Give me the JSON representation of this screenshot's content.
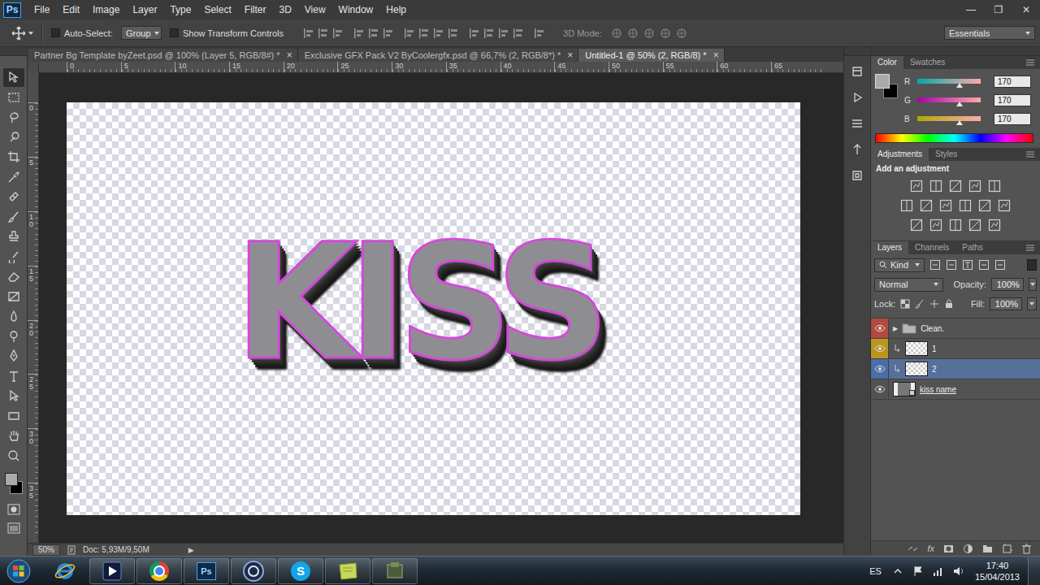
{
  "app": {
    "logo": "Ps",
    "menu": [
      "File",
      "Edit",
      "Image",
      "Layer",
      "Type",
      "Select",
      "Filter",
      "3D",
      "View",
      "Window",
      "Help"
    ],
    "window_controls": [
      "—",
      "❐",
      "✕"
    ]
  },
  "options_bar": {
    "auto_select": {
      "label": "Auto-Select:",
      "checked": false
    },
    "auto_select_target": "Group",
    "show_transform": {
      "label": "Show Transform Controls",
      "checked": false
    },
    "mode_3d": "3D Mode:",
    "workspace": "Essentials"
  },
  "document_tabs": [
    {
      "label": "Partner Bg Template byZeet.psd @ 100% (Layer 5, RGB/8#) *",
      "close": "×",
      "selected": false
    },
    {
      "label": "Exclusive GFX Pack V2 ByCoolergfx.psd @ 66,7% (2, RGB/8*) *",
      "close": "×",
      "selected": false
    },
    {
      "label": "Untitled-1 @ 50% (2, RGB/8) *",
      "close": "×",
      "selected": true
    }
  ],
  "rulers": {
    "top": [
      "0",
      "5",
      "10",
      "15",
      "20",
      "25",
      "30",
      "35",
      "40",
      "45",
      "50",
      "55",
      "60",
      "65"
    ],
    "left": [
      "0",
      "5",
      "10",
      "15",
      "20",
      "25",
      "30",
      "35"
    ]
  },
  "canvas": {
    "artwork_text": "KISS"
  },
  "status_bar": {
    "zoom": "50%",
    "doc": "Doc: 5,93M/9,50M",
    "menu_arrow": "▶"
  },
  "color_panel": {
    "tabs": [
      {
        "label": "Color",
        "selected": true
      },
      {
        "label": "Swatches",
        "selected": false
      }
    ],
    "foreground": "#aaaaaa",
    "background": "#000000",
    "channels": [
      {
        "name": "R",
        "value": "170",
        "level": 0.667,
        "color": "#00aaaa"
      },
      {
        "name": "G",
        "value": "170",
        "level": 0.667,
        "color": "#aa00aa"
      },
      {
        "name": "B",
        "value": "170",
        "level": 0.667,
        "color": "#aaaa00"
      }
    ]
  },
  "adjustments_panel": {
    "tabs": [
      {
        "label": "Adjustments",
        "selected": true
      },
      {
        "label": "Styles",
        "selected": false
      }
    ],
    "heading": "Add an adjustment"
  },
  "layers_panel": {
    "tabs": [
      {
        "label": "Layers",
        "selected": true
      },
      {
        "label": "Channels",
        "selected": false
      },
      {
        "label": "Paths",
        "selected": false
      }
    ],
    "filter": "Kind",
    "blend_mode": "Normal",
    "opacity_label": "Opacity:",
    "opacity": "100%",
    "lock_label": "Lock:",
    "fill_label": "Fill:",
    "fill": "100%",
    "layers": [
      {
        "name": "Clean.",
        "kind": "group",
        "visible": true,
        "color": "#b5483f",
        "selected": false,
        "clipped": false,
        "expanded": false,
        "toggle": "▶",
        "underlined": false
      },
      {
        "name": "1",
        "kind": "layer",
        "visible": true,
        "color": "#b8961f",
        "selected": false,
        "clipped": true,
        "underlined": false
      },
      {
        "name": "2",
        "kind": "layer",
        "visible": true,
        "color": "#4a6ea8",
        "selected": true,
        "clipped": true,
        "underlined": false
      },
      {
        "name": "kiss name",
        "kind": "smart-object",
        "visible": true,
        "color": null,
        "selected": false,
        "clipped": false,
        "underlined": true
      }
    ],
    "footer_fx": "fx"
  },
  "taskbar": {
    "items": [
      {
        "kind": "ie",
        "running": false
      },
      {
        "kind": "media",
        "running": true
      },
      {
        "kind": "chrome",
        "running": true
      },
      {
        "kind": "photoshop",
        "running": true,
        "label": "Ps"
      },
      {
        "kind": "cinema",
        "running": true
      },
      {
        "kind": "skype",
        "running": true,
        "label": "S"
      },
      {
        "kind": "notes",
        "running": true
      },
      {
        "kind": "app",
        "running": true
      }
    ],
    "language": "ES",
    "time": "17:40",
    "date": "15/04/2013"
  }
}
